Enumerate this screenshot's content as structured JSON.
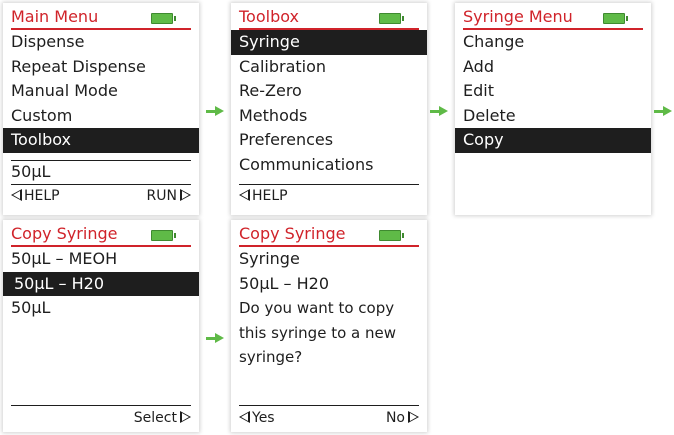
{
  "colors": {
    "accent": "#d0232a",
    "battery": "#5fba47",
    "selection": "#1e1e1e"
  },
  "screens": {
    "main_menu": {
      "title": "Main Menu",
      "items": [
        "Dispense",
        "Repeat Dispense",
        "Manual Mode",
        "Custom",
        "Toolbox"
      ],
      "selected": "Toolbox",
      "status": "50µL",
      "footer_left": "HELP",
      "footer_right": "RUN"
    },
    "toolbox": {
      "title": "Toolbox",
      "items": [
        "Syringe",
        "Calibration",
        "Re-Zero",
        "Methods",
        "Preferences",
        "Communications"
      ],
      "selected": "Syringe",
      "footer_left": "HELP"
    },
    "syringe_menu": {
      "title": "Syringe Menu",
      "items": [
        "Change",
        "Add",
        "Edit",
        "Delete",
        "Copy"
      ],
      "selected": "Copy"
    },
    "copy_syringe_select": {
      "title": "Copy Syringe",
      "items": [
        "50µL – MEOH",
        "50µL – H20",
        "50µL"
      ],
      "selected": "50µL – H20",
      "footer_right": "Select"
    },
    "copy_syringe_confirm": {
      "title": "Copy Syringe",
      "line1": "Syringe",
      "line2": "50µL – H20",
      "line3": "Do you want to copy",
      "line4": "this syringe to a new",
      "line5": "syringe?",
      "footer_left": "Yes",
      "footer_right": "No"
    }
  }
}
